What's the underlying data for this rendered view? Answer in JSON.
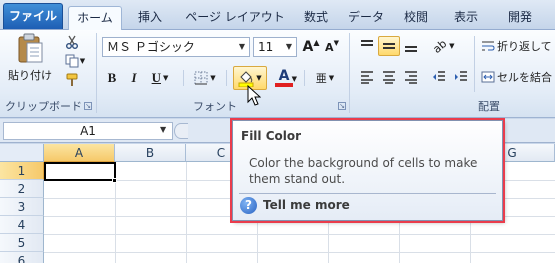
{
  "tabs": [
    {
      "id": "file",
      "label": "ファイル"
    },
    {
      "id": "home",
      "label": "ホーム"
    },
    {
      "id": "insert",
      "label": "挿入"
    },
    {
      "id": "page-layout",
      "label": "ページ レイアウト"
    },
    {
      "id": "formulas",
      "label": "数式"
    },
    {
      "id": "data",
      "label": "データ"
    },
    {
      "id": "review",
      "label": "校閲"
    },
    {
      "id": "view",
      "label": "表示"
    },
    {
      "id": "developer",
      "label": "開発"
    }
  ],
  "ribbon": {
    "clipboard": {
      "label": "クリップボード",
      "paste_label": "貼り付け"
    },
    "font": {
      "label": "フォント",
      "font_name": "ＭＳ Ｐゴシック",
      "font_size": "11",
      "bold_label": "B",
      "italic_label": "I",
      "underline_label": "U",
      "grow_label": "A",
      "shrink_label": "A",
      "font_color_label": "A",
      "font_color": "#e02020",
      "fill_color": "#ffff00"
    },
    "alignment": {
      "label": "配置",
      "wrap_text_label": "折り返して",
      "merge_label": "セルを結合"
    }
  },
  "formula_bar": {
    "name_box": "A1"
  },
  "grid": {
    "columns": [
      "A",
      "B",
      "C",
      "D",
      "E",
      "F",
      "G"
    ],
    "rows": [
      "1",
      "2",
      "3",
      "4",
      "5",
      "6"
    ],
    "selected_column": "A",
    "selected_row": "1"
  },
  "tooltip": {
    "title": "Fill Color",
    "body": "Color the background of cells to make them stand out.",
    "help_text": "Tell me more",
    "help_icon_label": "?"
  },
  "colors": {
    "tooltip_outline": "#ea3c4c",
    "selection": "#f6c96a",
    "file_tab": "#1e5eb4"
  }
}
